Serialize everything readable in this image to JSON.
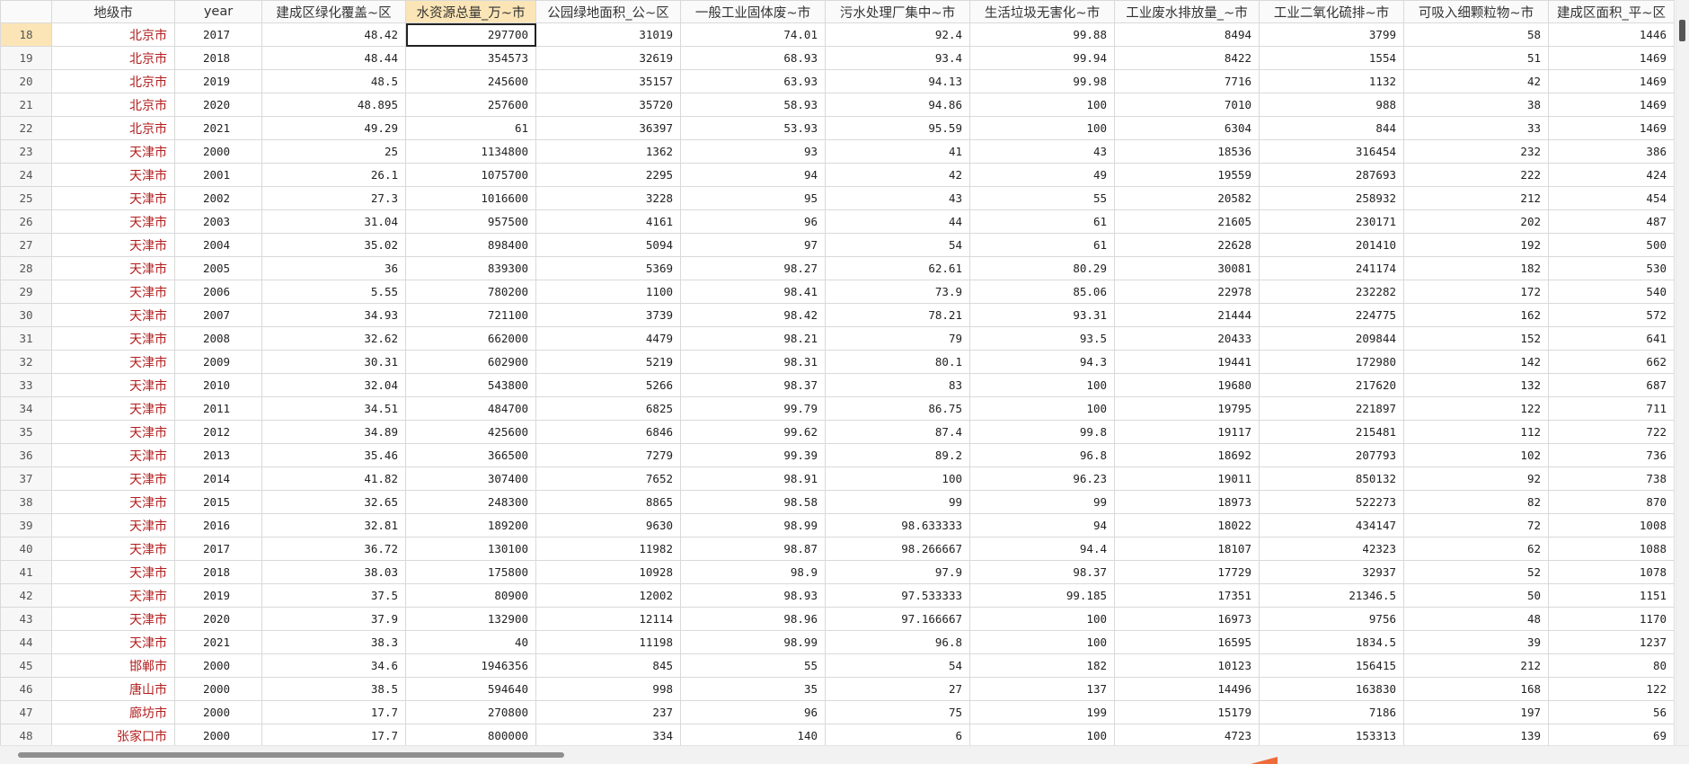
{
  "columns": [
    "",
    "地级市",
    "year",
    "建成区绿化覆盖~区",
    "水资源总量_万~市",
    "公园绿地面积_公~区",
    "一般工业固体废~市",
    "污水处理厂集中~市",
    "生活垃圾无害化~市",
    "工业废水排放量_~市",
    "工业二氧化硫排~市",
    "可吸入细颗粒物~市",
    "建成区面积_平~区"
  ],
  "selected_column": 4,
  "selected_row_number": "18",
  "rows": [
    {
      "n": "18",
      "c": [
        "北京市",
        "2017",
        "48.42",
        "297700",
        "31019",
        "74.01",
        "92.4",
        "99.88",
        "8494",
        "3799",
        "58",
        "1446"
      ]
    },
    {
      "n": "19",
      "c": [
        "北京市",
        "2018",
        "48.44",
        "354573",
        "32619",
        "68.93",
        "93.4",
        "99.94",
        "8422",
        "1554",
        "51",
        "1469"
      ]
    },
    {
      "n": "20",
      "c": [
        "北京市",
        "2019",
        "48.5",
        "245600",
        "35157",
        "63.93",
        "94.13",
        "99.98",
        "7716",
        "1132",
        "42",
        "1469"
      ]
    },
    {
      "n": "21",
      "c": [
        "北京市",
        "2020",
        "48.895",
        "257600",
        "35720",
        "58.93",
        "94.86",
        "100",
        "7010",
        "988",
        "38",
        "1469"
      ]
    },
    {
      "n": "22",
      "c": [
        "北京市",
        "2021",
        "49.29",
        "61",
        "36397",
        "53.93",
        "95.59",
        "100",
        "6304",
        "844",
        "33",
        "1469"
      ]
    },
    {
      "n": "23",
      "c": [
        "天津市",
        "2000",
        "25",
        "1134800",
        "1362",
        "93",
        "41",
        "43",
        "18536",
        "316454",
        "232",
        "386"
      ]
    },
    {
      "n": "24",
      "c": [
        "天津市",
        "2001",
        "26.1",
        "1075700",
        "2295",
        "94",
        "42",
        "49",
        "19559",
        "287693",
        "222",
        "424"
      ]
    },
    {
      "n": "25",
      "c": [
        "天津市",
        "2002",
        "27.3",
        "1016600",
        "3228",
        "95",
        "43",
        "55",
        "20582",
        "258932",
        "212",
        "454"
      ]
    },
    {
      "n": "26",
      "c": [
        "天津市",
        "2003",
        "31.04",
        "957500",
        "4161",
        "96",
        "44",
        "61",
        "21605",
        "230171",
        "202",
        "487"
      ]
    },
    {
      "n": "27",
      "c": [
        "天津市",
        "2004",
        "35.02",
        "898400",
        "5094",
        "97",
        "54",
        "61",
        "22628",
        "201410",
        "192",
        "500"
      ]
    },
    {
      "n": "28",
      "c": [
        "天津市",
        "2005",
        "36",
        "839300",
        "5369",
        "98.27",
        "62.61",
        "80.29",
        "30081",
        "241174",
        "182",
        "530"
      ]
    },
    {
      "n": "29",
      "c": [
        "天津市",
        "2006",
        "5.55",
        "780200",
        "1100",
        "98.41",
        "73.9",
        "85.06",
        "22978",
        "232282",
        "172",
        "540"
      ]
    },
    {
      "n": "30",
      "c": [
        "天津市",
        "2007",
        "34.93",
        "721100",
        "3739",
        "98.42",
        "78.21",
        "93.31",
        "21444",
        "224775",
        "162",
        "572"
      ]
    },
    {
      "n": "31",
      "c": [
        "天津市",
        "2008",
        "32.62",
        "662000",
        "4479",
        "98.21",
        "79",
        "93.5",
        "20433",
        "209844",
        "152",
        "641"
      ]
    },
    {
      "n": "32",
      "c": [
        "天津市",
        "2009",
        "30.31",
        "602900",
        "5219",
        "98.31",
        "80.1",
        "94.3",
        "19441",
        "172980",
        "142",
        "662"
      ]
    },
    {
      "n": "33",
      "c": [
        "天津市",
        "2010",
        "32.04",
        "543800",
        "5266",
        "98.37",
        "83",
        "100",
        "19680",
        "217620",
        "132",
        "687"
      ]
    },
    {
      "n": "34",
      "c": [
        "天津市",
        "2011",
        "34.51",
        "484700",
        "6825",
        "99.79",
        "86.75",
        "100",
        "19795",
        "221897",
        "122",
        "711"
      ]
    },
    {
      "n": "35",
      "c": [
        "天津市",
        "2012",
        "34.89",
        "425600",
        "6846",
        "99.62",
        "87.4",
        "99.8",
        "19117",
        "215481",
        "112",
        "722"
      ]
    },
    {
      "n": "36",
      "c": [
        "天津市",
        "2013",
        "35.46",
        "366500",
        "7279",
        "99.39",
        "89.2",
        "96.8",
        "18692",
        "207793",
        "102",
        "736"
      ]
    },
    {
      "n": "37",
      "c": [
        "天津市",
        "2014",
        "41.82",
        "307400",
        "7652",
        "98.91",
        "100",
        "96.23",
        "19011",
        "850132",
        "92",
        "738"
      ]
    },
    {
      "n": "38",
      "c": [
        "天津市",
        "2015",
        "32.65",
        "248300",
        "8865",
        "98.58",
        "99",
        "99",
        "18973",
        "522273",
        "82",
        "870"
      ]
    },
    {
      "n": "39",
      "c": [
        "天津市",
        "2016",
        "32.81",
        "189200",
        "9630",
        "98.99",
        "98.633333",
        "94",
        "18022",
        "434147",
        "72",
        "1008"
      ]
    },
    {
      "n": "40",
      "c": [
        "天津市",
        "2017",
        "36.72",
        "130100",
        "11982",
        "98.87",
        "98.266667",
        "94.4",
        "18107",
        "42323",
        "62",
        "1088"
      ]
    },
    {
      "n": "41",
      "c": [
        "天津市",
        "2018",
        "38.03",
        "175800",
        "10928",
        "98.9",
        "97.9",
        "98.37",
        "17729",
        "32937",
        "52",
        "1078"
      ]
    },
    {
      "n": "42",
      "c": [
        "天津市",
        "2019",
        "37.5",
        "80900",
        "12002",
        "98.93",
        "97.533333",
        "99.185",
        "17351",
        "21346.5",
        "50",
        "1151"
      ]
    },
    {
      "n": "43",
      "c": [
        "天津市",
        "2020",
        "37.9",
        "132900",
        "12114",
        "98.96",
        "97.166667",
        "100",
        "16973",
        "9756",
        "48",
        "1170"
      ]
    },
    {
      "n": "44",
      "c": [
        "天津市",
        "2021",
        "38.3",
        "40",
        "11198",
        "98.99",
        "96.8",
        "100",
        "16595",
        "1834.5",
        "39",
        "1237"
      ]
    },
    {
      "n": "45",
      "c": [
        "邯郸市",
        "2000",
        "34.6",
        "1946356",
        "845",
        "55",
        "54",
        "182",
        "10123",
        "156415",
        "212",
        "80"
      ]
    },
    {
      "n": "46",
      "c": [
        "唐山市",
        "2000",
        "38.5",
        "594640",
        "998",
        "35",
        "27",
        "137",
        "14496",
        "163830",
        "168",
        "122"
      ]
    },
    {
      "n": "47",
      "c": [
        "廊坊市",
        "2000",
        "17.7",
        "270800",
        "237",
        "96",
        "75",
        "199",
        "15179",
        "7186",
        "197",
        "56"
      ]
    },
    {
      "n": "48",
      "c": [
        "张家口市",
        "2000",
        "17.7",
        "800000",
        "334",
        "140",
        "6",
        "100",
        "4723",
        "153313",
        "139",
        "69"
      ]
    }
  ]
}
